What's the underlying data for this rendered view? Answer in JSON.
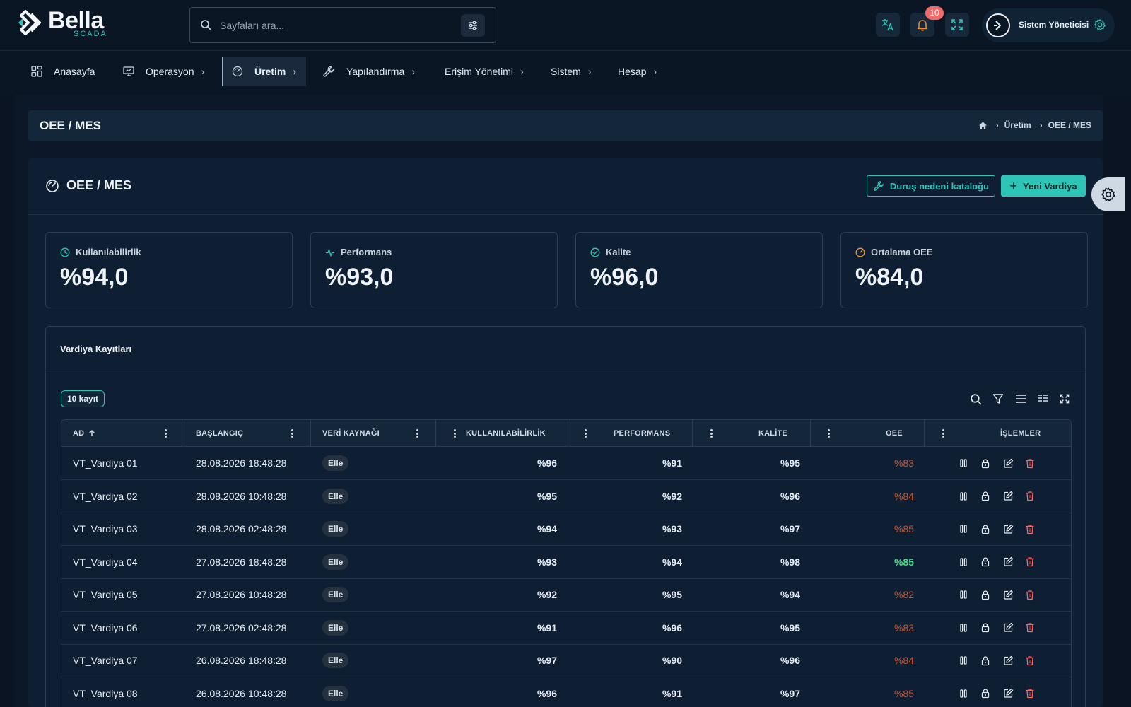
{
  "header": {
    "logo_word": "Bella",
    "logo_sub": "SCADA",
    "search_placeholder": "Sayfaları ara...",
    "notification_count": "10",
    "user_name": "Sistem Yöneticisi"
  },
  "nav": {
    "items": [
      {
        "label": "Anasayfa"
      },
      {
        "label": "Operasyon"
      },
      {
        "label": "Üretim"
      },
      {
        "label": "Yapılandırma"
      },
      {
        "label": "Erişim Yönetimi"
      },
      {
        "label": "Sistem"
      },
      {
        "label": "Hesap"
      }
    ]
  },
  "page": {
    "title": "OEE / MES",
    "breadcrumb": [
      "Üretim",
      "OEE / MES"
    ]
  },
  "card": {
    "title": "OEE / MES",
    "catalog_button": "Duruş nedeni kataloğu",
    "new_button": "Yeni Vardiya"
  },
  "kpis": [
    {
      "label": "Kullanılabilirlik",
      "value": "%94,0",
      "icon": "clock-icon",
      "color": "#2ec4b6"
    },
    {
      "label": "Performans",
      "value": "%93,0",
      "icon": "pulse-icon",
      "color": "#2ec4b6"
    },
    {
      "label": "Kalite",
      "value": "%96,0",
      "icon": "check-circle-icon",
      "color": "#2ec4b6"
    },
    {
      "label": "Ortalama OEE",
      "value": "%84,0",
      "icon": "gauge-icon",
      "color": "#e8912e"
    }
  ],
  "table": {
    "title": "Vardiya Kayıtları",
    "count": "10 kayıt",
    "columns": [
      "AD",
      "BAŞLANGIÇ",
      "VERİ KAYNAĞI",
      "KULLANILABİLİRLİK",
      "PERFORMANS",
      "KALİTE",
      "OEE",
      "İŞLEMLER"
    ],
    "rows": [
      {
        "name": "VT_Vardiya 01",
        "start": "28.08.2026 18:48:28",
        "source": "Elle",
        "avail": "%96",
        "perf": "%91",
        "quality": "%95",
        "oee": "%83",
        "oee_color": "#c4532f"
      },
      {
        "name": "VT_Vardiya 02",
        "start": "28.08.2026 10:48:28",
        "source": "Elle",
        "avail": "%95",
        "perf": "%92",
        "quality": "%96",
        "oee": "%84",
        "oee_color": "#c4532f"
      },
      {
        "name": "VT_Vardiya 03",
        "start": "28.08.2026 02:48:28",
        "source": "Elle",
        "avail": "%94",
        "perf": "%93",
        "quality": "%97",
        "oee": "%85",
        "oee_color": "#c4532f"
      },
      {
        "name": "VT_Vardiya 04",
        "start": "27.08.2026 18:48:28",
        "source": "Elle",
        "avail": "%93",
        "perf": "%94",
        "quality": "%98",
        "oee": "%85",
        "oee_color": "#3ddc84"
      },
      {
        "name": "VT_Vardiya 05",
        "start": "27.08.2026 10:48:28",
        "source": "Elle",
        "avail": "%92",
        "perf": "%95",
        "quality": "%94",
        "oee": "%82",
        "oee_color": "#c4532f"
      },
      {
        "name": "VT_Vardiya 06",
        "start": "27.08.2026 02:48:28",
        "source": "Elle",
        "avail": "%91",
        "perf": "%96",
        "quality": "%95",
        "oee": "%83",
        "oee_color": "#c4532f"
      },
      {
        "name": "VT_Vardiya 07",
        "start": "26.08.2026 18:48:28",
        "source": "Elle",
        "avail": "%97",
        "perf": "%90",
        "quality": "%96",
        "oee": "%84",
        "oee_color": "#c4532f"
      },
      {
        "name": "VT_Vardiya 08",
        "start": "26.08.2026 10:48:28",
        "source": "Elle",
        "avail": "%96",
        "perf": "%91",
        "quality": "%97",
        "oee": "%85",
        "oee_color": "#c4532f"
      }
    ]
  },
  "colors": {
    "accent": "#2ec4b6",
    "danger": "#f26b6b",
    "oee_low": "#c4532f",
    "oee_good": "#3ddc84"
  }
}
